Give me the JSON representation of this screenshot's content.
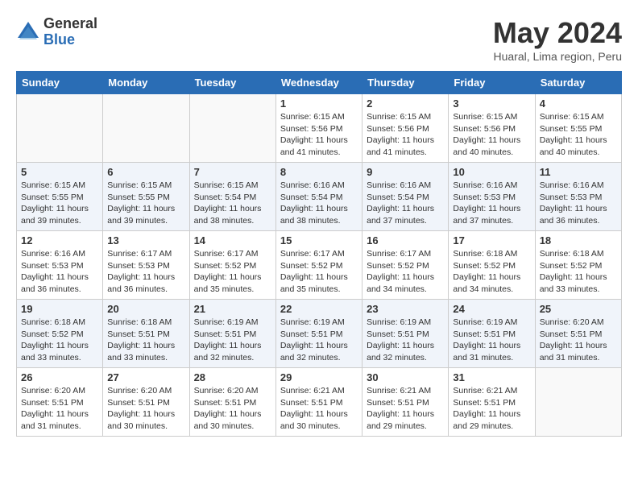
{
  "logo": {
    "general": "General",
    "blue": "Blue"
  },
  "title": "May 2024",
  "location": "Huaral, Lima region, Peru",
  "days_of_week": [
    "Sunday",
    "Monday",
    "Tuesday",
    "Wednesday",
    "Thursday",
    "Friday",
    "Saturday"
  ],
  "weeks": [
    {
      "shaded": false,
      "days": [
        {
          "number": "",
          "info": ""
        },
        {
          "number": "",
          "info": ""
        },
        {
          "number": "",
          "info": ""
        },
        {
          "number": "1",
          "sunrise": "6:15 AM",
          "sunset": "5:56 PM",
          "daylight": "11 hours and 41 minutes."
        },
        {
          "number": "2",
          "sunrise": "6:15 AM",
          "sunset": "5:56 PM",
          "daylight": "11 hours and 41 minutes."
        },
        {
          "number": "3",
          "sunrise": "6:15 AM",
          "sunset": "5:56 PM",
          "daylight": "11 hours and 40 minutes."
        },
        {
          "number": "4",
          "sunrise": "6:15 AM",
          "sunset": "5:55 PM",
          "daylight": "11 hours and 40 minutes."
        }
      ]
    },
    {
      "shaded": true,
      "days": [
        {
          "number": "5",
          "sunrise": "6:15 AM",
          "sunset": "5:55 PM",
          "daylight": "11 hours and 39 minutes."
        },
        {
          "number": "6",
          "sunrise": "6:15 AM",
          "sunset": "5:55 PM",
          "daylight": "11 hours and 39 minutes."
        },
        {
          "number": "7",
          "sunrise": "6:15 AM",
          "sunset": "5:54 PM",
          "daylight": "11 hours and 38 minutes."
        },
        {
          "number": "8",
          "sunrise": "6:16 AM",
          "sunset": "5:54 PM",
          "daylight": "11 hours and 38 minutes."
        },
        {
          "number": "9",
          "sunrise": "6:16 AM",
          "sunset": "5:54 PM",
          "daylight": "11 hours and 37 minutes."
        },
        {
          "number": "10",
          "sunrise": "6:16 AM",
          "sunset": "5:53 PM",
          "daylight": "11 hours and 37 minutes."
        },
        {
          "number": "11",
          "sunrise": "6:16 AM",
          "sunset": "5:53 PM",
          "daylight": "11 hours and 36 minutes."
        }
      ]
    },
    {
      "shaded": false,
      "days": [
        {
          "number": "12",
          "sunrise": "6:16 AM",
          "sunset": "5:53 PM",
          "daylight": "11 hours and 36 minutes."
        },
        {
          "number": "13",
          "sunrise": "6:17 AM",
          "sunset": "5:53 PM",
          "daylight": "11 hours and 36 minutes."
        },
        {
          "number": "14",
          "sunrise": "6:17 AM",
          "sunset": "5:52 PM",
          "daylight": "11 hours and 35 minutes."
        },
        {
          "number": "15",
          "sunrise": "6:17 AM",
          "sunset": "5:52 PM",
          "daylight": "11 hours and 35 minutes."
        },
        {
          "number": "16",
          "sunrise": "6:17 AM",
          "sunset": "5:52 PM",
          "daylight": "11 hours and 34 minutes."
        },
        {
          "number": "17",
          "sunrise": "6:18 AM",
          "sunset": "5:52 PM",
          "daylight": "11 hours and 34 minutes."
        },
        {
          "number": "18",
          "sunrise": "6:18 AM",
          "sunset": "5:52 PM",
          "daylight": "11 hours and 33 minutes."
        }
      ]
    },
    {
      "shaded": true,
      "days": [
        {
          "number": "19",
          "sunrise": "6:18 AM",
          "sunset": "5:52 PM",
          "daylight": "11 hours and 33 minutes."
        },
        {
          "number": "20",
          "sunrise": "6:18 AM",
          "sunset": "5:51 PM",
          "daylight": "11 hours and 33 minutes."
        },
        {
          "number": "21",
          "sunrise": "6:19 AM",
          "sunset": "5:51 PM",
          "daylight": "11 hours and 32 minutes."
        },
        {
          "number": "22",
          "sunrise": "6:19 AM",
          "sunset": "5:51 PM",
          "daylight": "11 hours and 32 minutes."
        },
        {
          "number": "23",
          "sunrise": "6:19 AM",
          "sunset": "5:51 PM",
          "daylight": "11 hours and 32 minutes."
        },
        {
          "number": "24",
          "sunrise": "6:19 AM",
          "sunset": "5:51 PM",
          "daylight": "11 hours and 31 minutes."
        },
        {
          "number": "25",
          "sunrise": "6:20 AM",
          "sunset": "5:51 PM",
          "daylight": "11 hours and 31 minutes."
        }
      ]
    },
    {
      "shaded": false,
      "days": [
        {
          "number": "26",
          "sunrise": "6:20 AM",
          "sunset": "5:51 PM",
          "daylight": "11 hours and 31 minutes."
        },
        {
          "number": "27",
          "sunrise": "6:20 AM",
          "sunset": "5:51 PM",
          "daylight": "11 hours and 30 minutes."
        },
        {
          "number": "28",
          "sunrise": "6:20 AM",
          "sunset": "5:51 PM",
          "daylight": "11 hours and 30 minutes."
        },
        {
          "number": "29",
          "sunrise": "6:21 AM",
          "sunset": "5:51 PM",
          "daylight": "11 hours and 30 minutes."
        },
        {
          "number": "30",
          "sunrise": "6:21 AM",
          "sunset": "5:51 PM",
          "daylight": "11 hours and 29 minutes."
        },
        {
          "number": "31",
          "sunrise": "6:21 AM",
          "sunset": "5:51 PM",
          "daylight": "11 hours and 29 minutes."
        },
        {
          "number": "",
          "info": ""
        }
      ]
    }
  ]
}
